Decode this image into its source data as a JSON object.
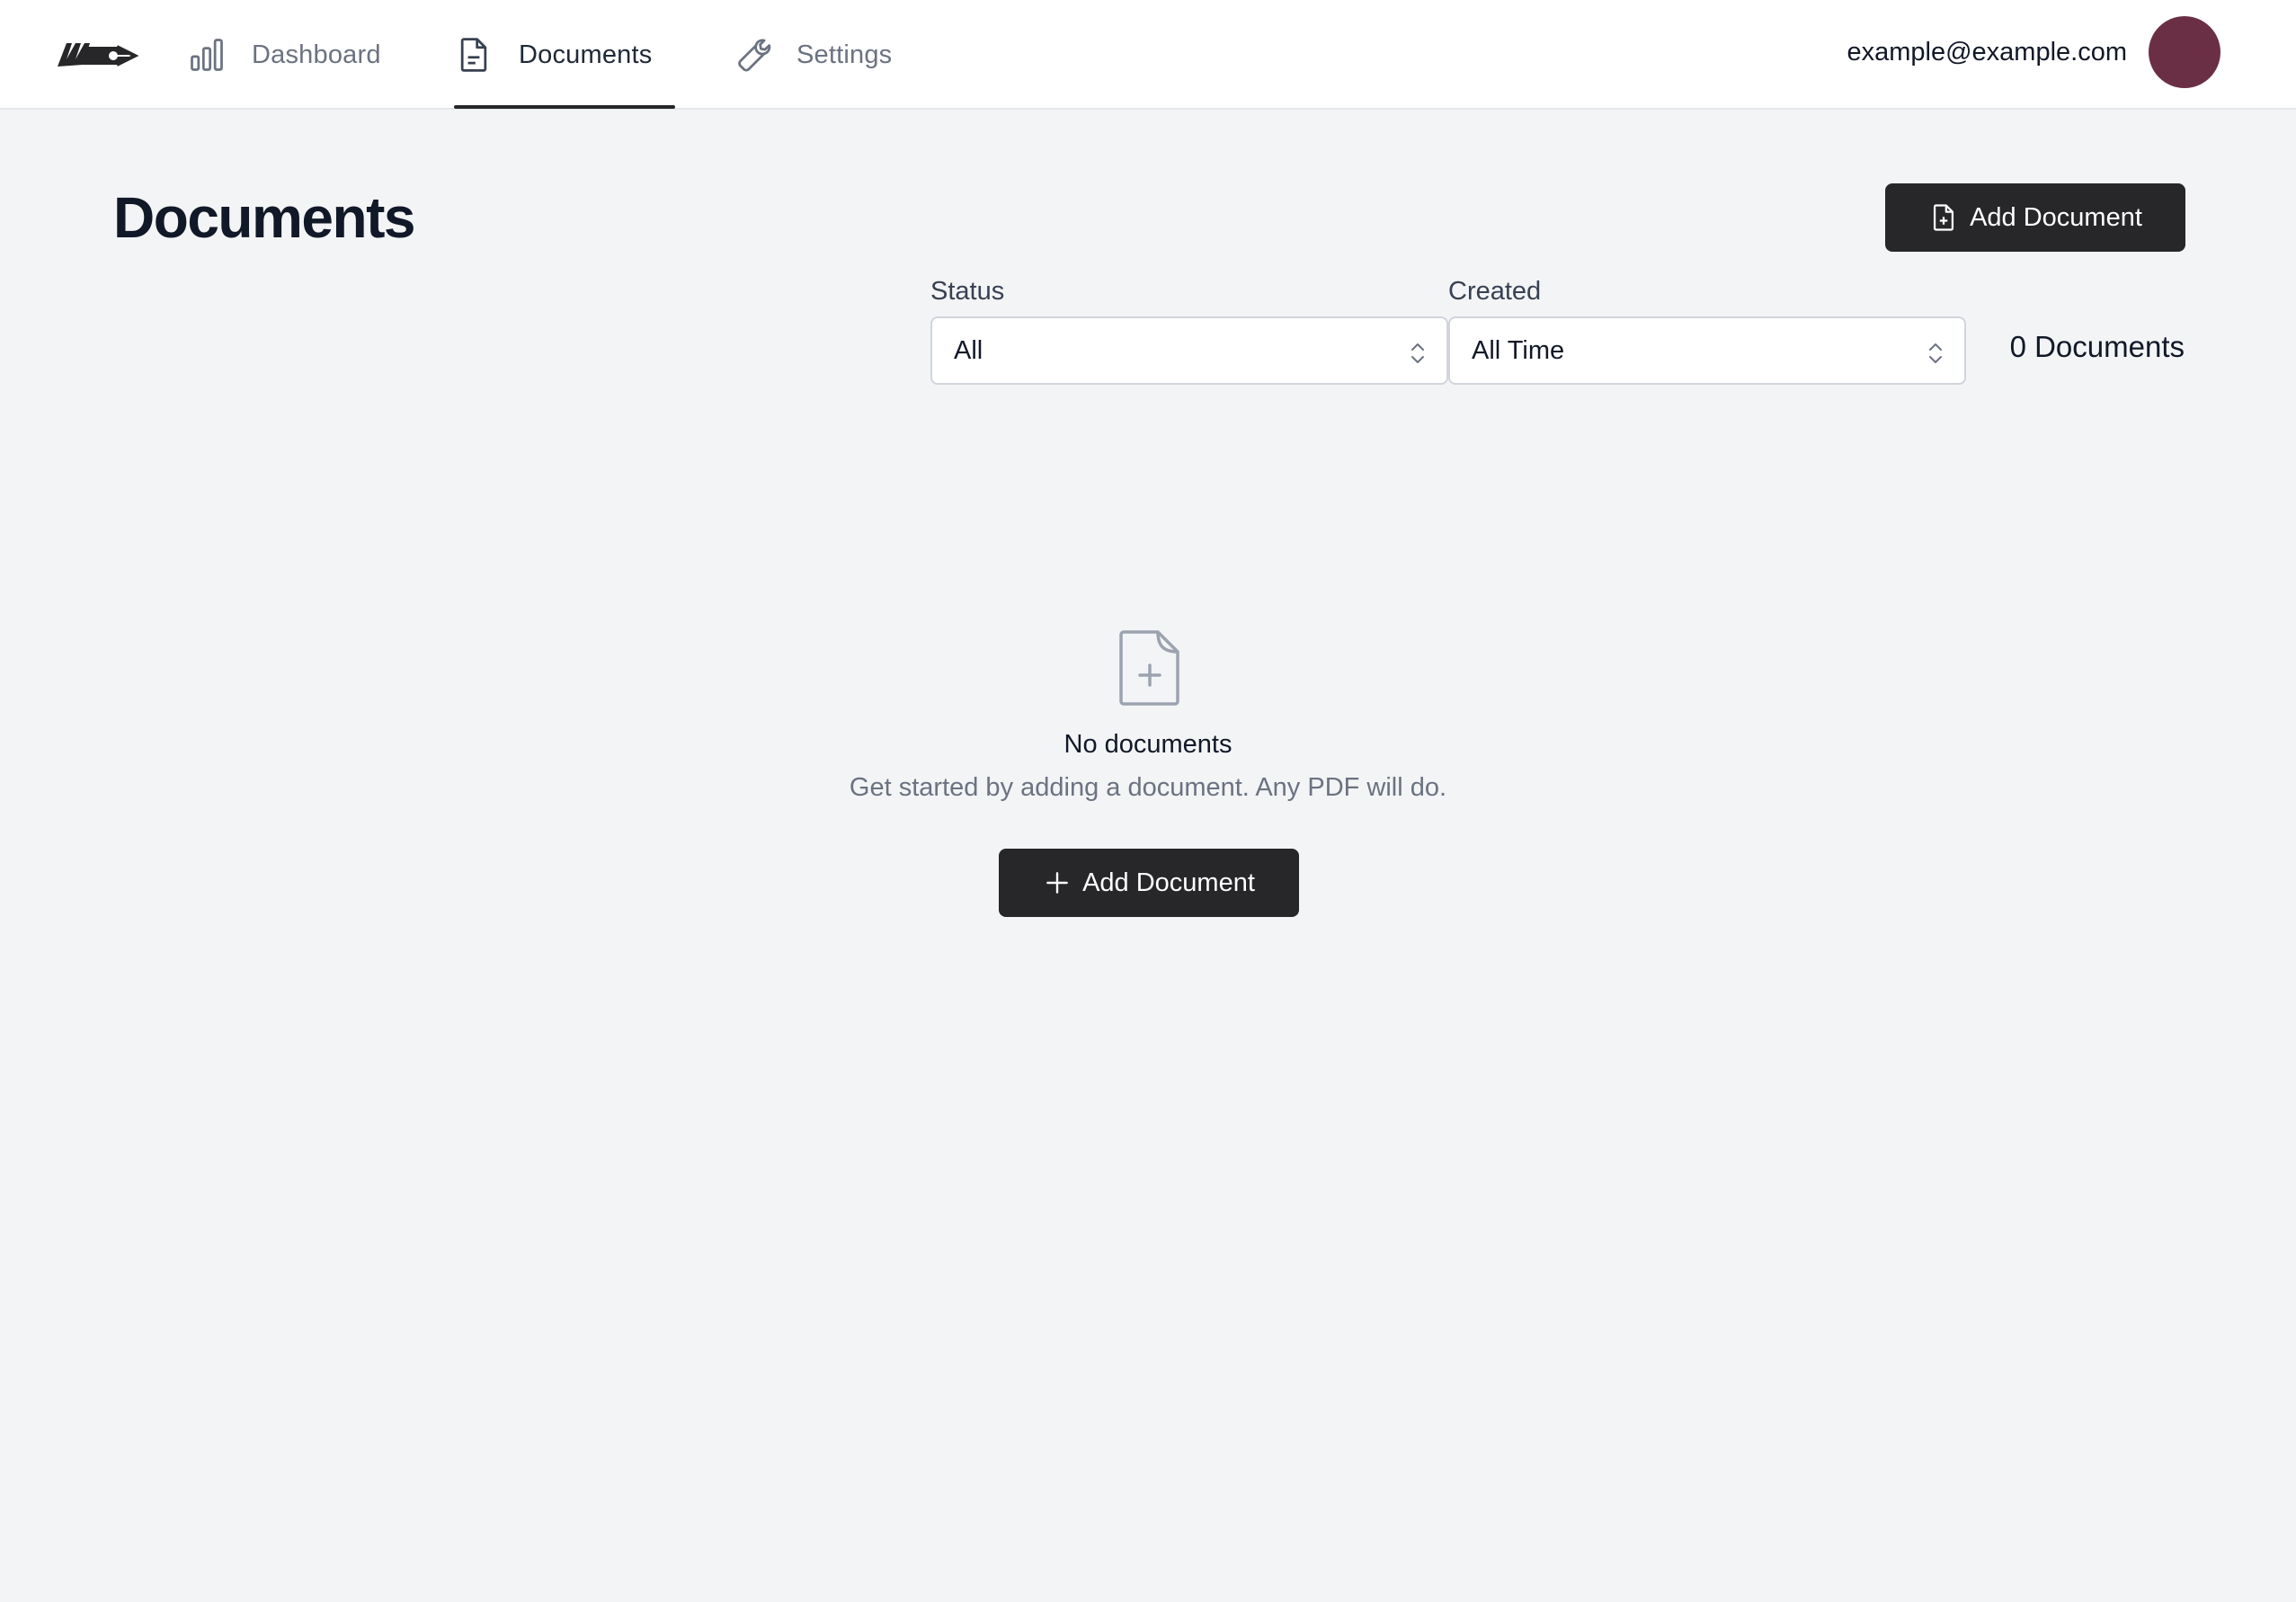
{
  "header": {
    "nav": [
      {
        "label": "Dashboard",
        "icon": "bar-chart-icon"
      },
      {
        "label": "Documents",
        "icon": "document-icon",
        "active": true
      },
      {
        "label": "Settings",
        "icon": "wrench-icon"
      }
    ],
    "user_email": "example@example.com",
    "avatar_color": "#6b2f45"
  },
  "main": {
    "title": "Documents",
    "add_button_label": "Add Document",
    "filters": {
      "status": {
        "label": "Status",
        "value": "All"
      },
      "created": {
        "label": "Created",
        "value": "All Time"
      }
    },
    "document_count": "0 Documents",
    "empty_state": {
      "title": "No documents",
      "subtitle": "Get started by adding a document. Any PDF will do.",
      "button_label": "Add Document"
    }
  },
  "colors": {
    "accent": "#27272a",
    "background": "#f3f4f6"
  }
}
